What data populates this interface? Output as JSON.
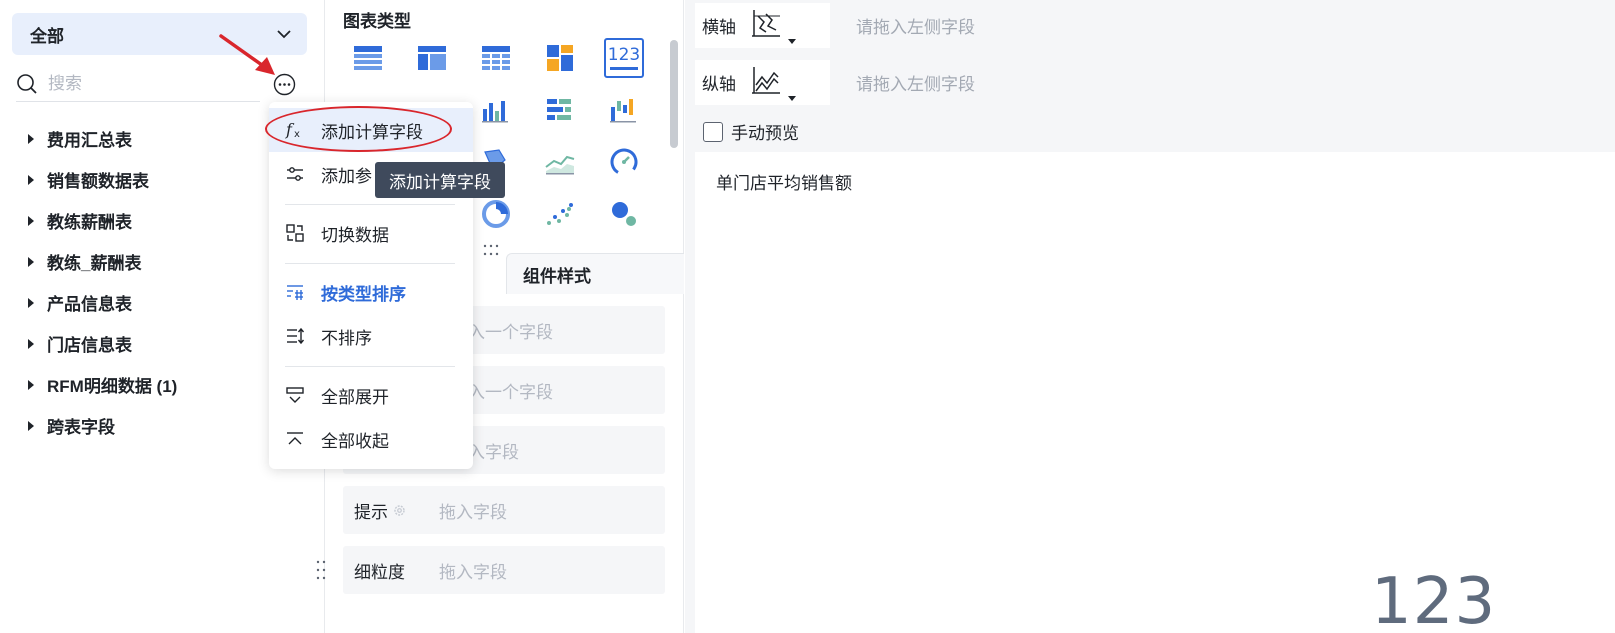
{
  "left": {
    "scope": "全部",
    "search_placeholder": "搜索",
    "tables": [
      "费用汇总表",
      "销售额数据表",
      "教练薪酬表",
      "教练_薪酬表",
      "产品信息表",
      "门店信息表",
      "RFM明细数据 (1)",
      "跨表字段"
    ]
  },
  "menu": {
    "add_calc_field": "添加计算字段",
    "add_param": "添加参",
    "switch_data": "切换数据",
    "sort_by_type": "按类型排序",
    "no_sort": "不排序",
    "expand_all": "全部展开",
    "collapse_all": "全部收起"
  },
  "tooltip": "添加计算字段",
  "middle": {
    "chart_type_title": "图表类型",
    "tab_component_style": "组件样式",
    "rows": [
      {
        "label": "",
        "placeholder": "入一个字段"
      },
      {
        "label": "",
        "placeholder": "入一个字段"
      },
      {
        "label": "",
        "placeholder": "入字段"
      },
      {
        "label": "提示",
        "placeholder": "拖入字段"
      },
      {
        "label": "细粒度",
        "placeholder": "拖入字段"
      }
    ]
  },
  "right": {
    "x_axis": {
      "label": "横轴",
      "placeholder": "请拖入左侧字段"
    },
    "y_axis": {
      "label": "纵轴",
      "placeholder": "请拖入左侧字段"
    },
    "manual_preview": "手动预览",
    "canvas_title": "单门店平均销售额",
    "kpi_value": "123"
  },
  "colors": {
    "accent": "#2f6bd9",
    "annotation_red": "#d9262c",
    "tooltip_bg": "#3f4a5c"
  }
}
